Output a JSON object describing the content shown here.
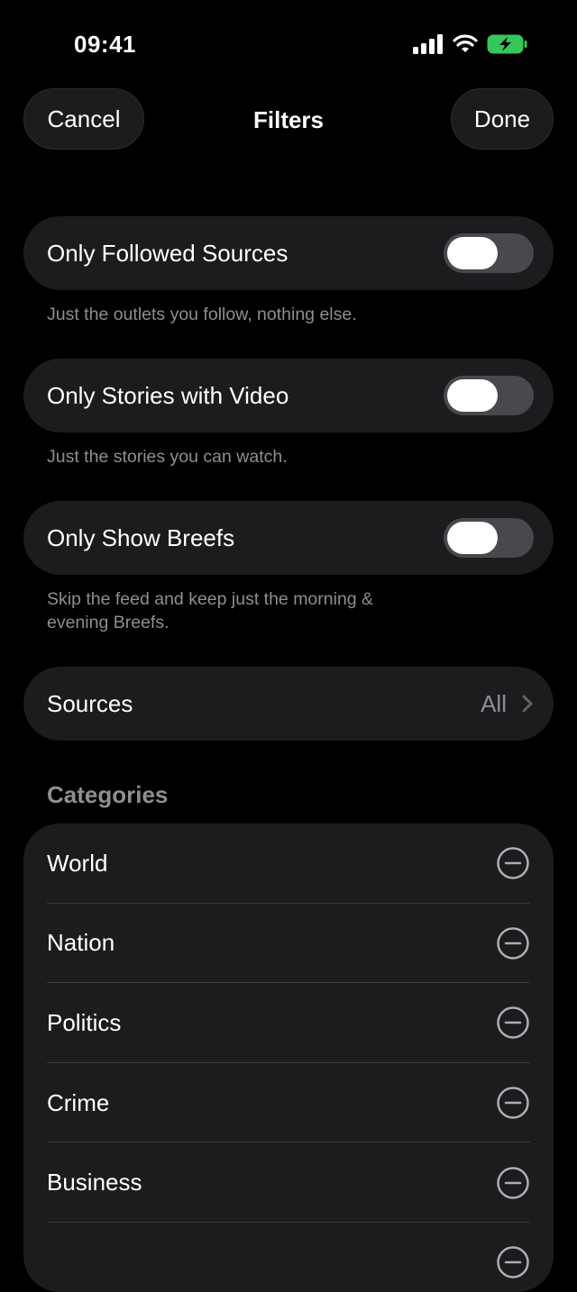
{
  "status_bar": {
    "time": "09:41"
  },
  "nav": {
    "cancel_label": "Cancel",
    "title": "Filters",
    "done_label": "Done"
  },
  "toggles": [
    {
      "label": "Only Followed Sources",
      "on": false,
      "footnote": "Just the outlets you follow, nothing else."
    },
    {
      "label": "Only Stories with Video",
      "on": false,
      "footnote": "Just the stories you can watch."
    },
    {
      "label": "Only Show Breefs",
      "on": false,
      "footnote": "Skip the feed and keep just the morning & evening Breefs."
    }
  ],
  "sources": {
    "label": "Sources",
    "value": "All"
  },
  "categories": {
    "header": "Categories",
    "items": [
      "World",
      "Nation",
      "Politics",
      "Crime",
      "Business"
    ]
  },
  "colors": {
    "background": "#000000",
    "card": "#1c1c1e",
    "secondary_text": "#8e8e93",
    "battery": "#34c759"
  },
  "icons": [
    "signal-icon",
    "wifi-icon",
    "battery-charging-icon",
    "chevron-right-icon",
    "minus-circle-icon"
  ]
}
